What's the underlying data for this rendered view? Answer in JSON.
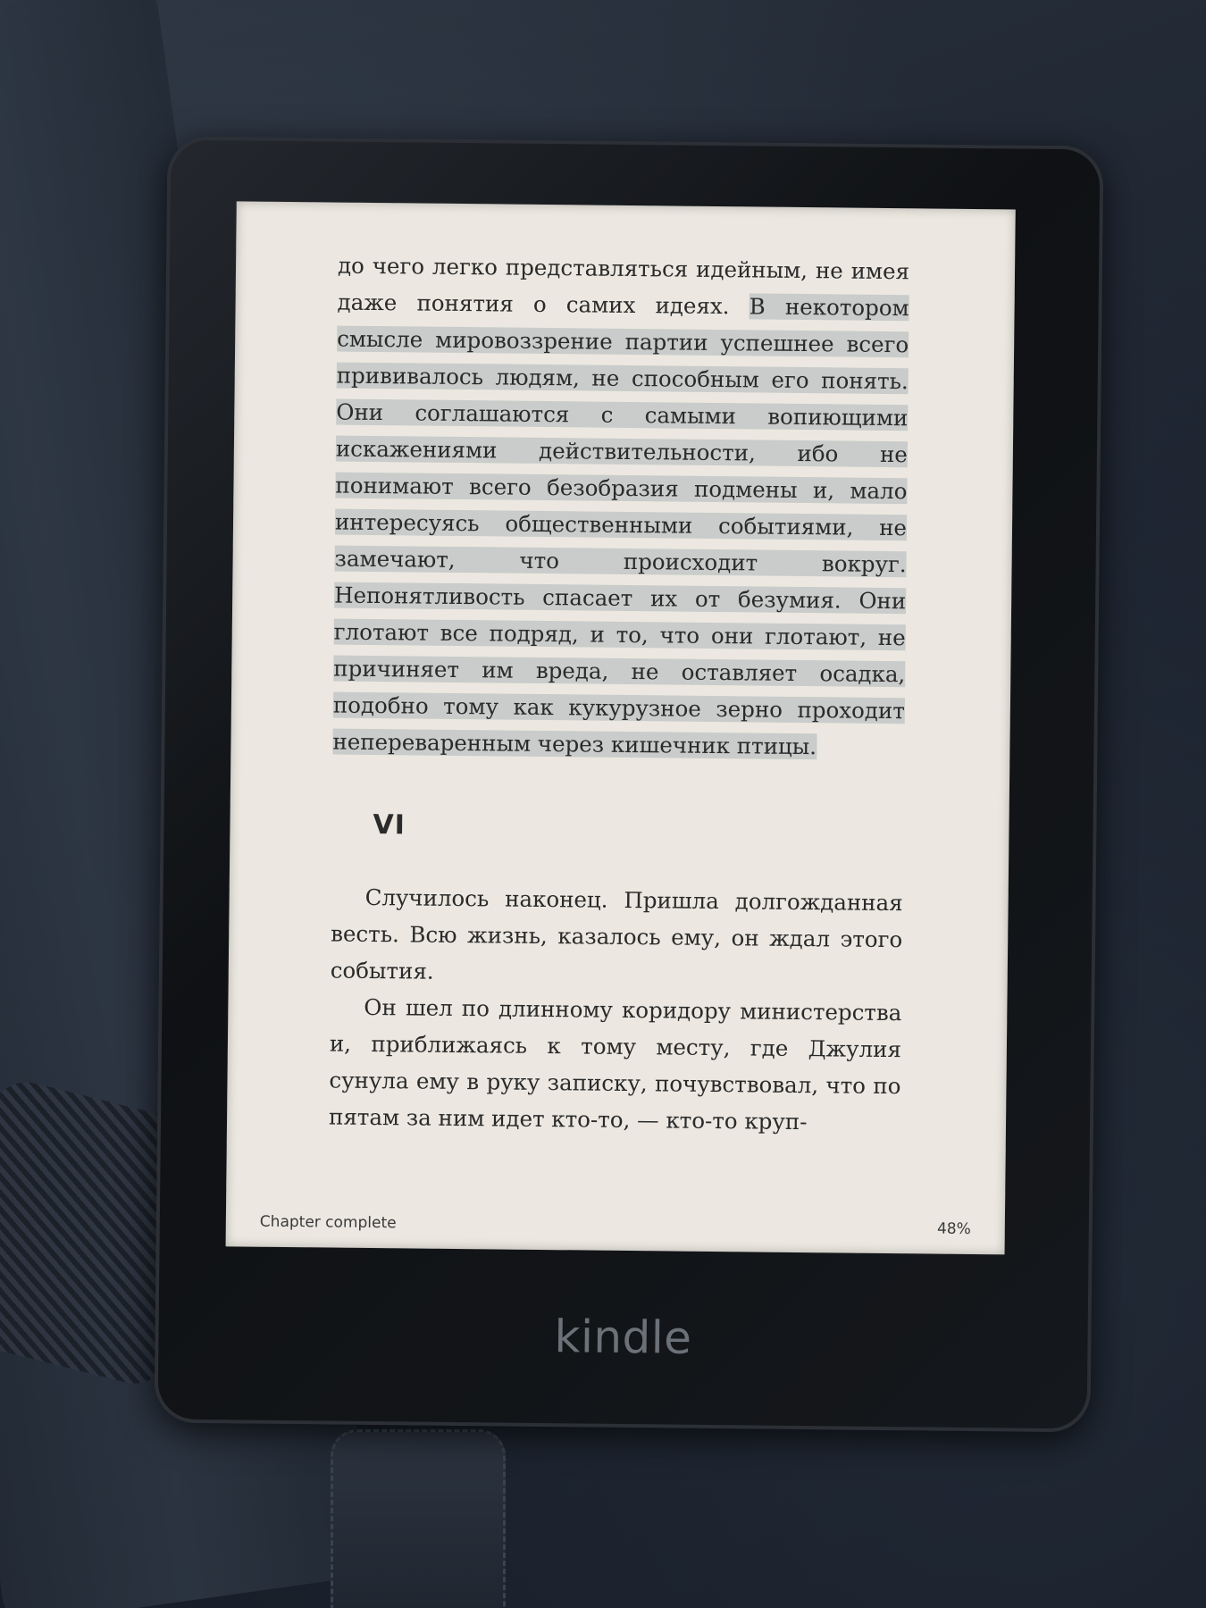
{
  "book": {
    "paragraph_1_plain": "до чего легко представляться идейным, не имея даже понятия о самих идеях. ",
    "paragraph_1_highlight": "В некотором смысле мировоззрение партии успешнее всего прививалось людям, не способным его понять. Они соглашаются с самыми вопиющими искажениями действительности, ибо не понимают всего безобразия подмены и, мало интересуясь общественными событиями, не замечают, что происходит вокруг. Непонятливость спасает их от безумия. Они глотают все подряд, и то, что они глотают, не причиняет им вреда, не оставляет осадка, подобно тому как кукурузное зерно проходит непереваренным через кишечник птицы.",
    "chapter_heading": "VI",
    "paragraph_2": "Случилось наконец. Пришла долгожданная весть. Всю жизнь, казалось ему, он ждал этого события.",
    "paragraph_3": "Он шел по длинному коридору министерства и, приближаясь к тому месту, где Джулия сунула ему в руку записку, почувствовал, что по пятам за ним идет кто-то, — кто-то круп-"
  },
  "status": {
    "chapter_progress": "Chapter complete",
    "book_percent": "48%"
  },
  "device": {
    "logo": "kindle"
  },
  "colors": {
    "screen_background": "#ece8e1",
    "highlight": "#c9ccca",
    "text": "#2a2a2a"
  }
}
